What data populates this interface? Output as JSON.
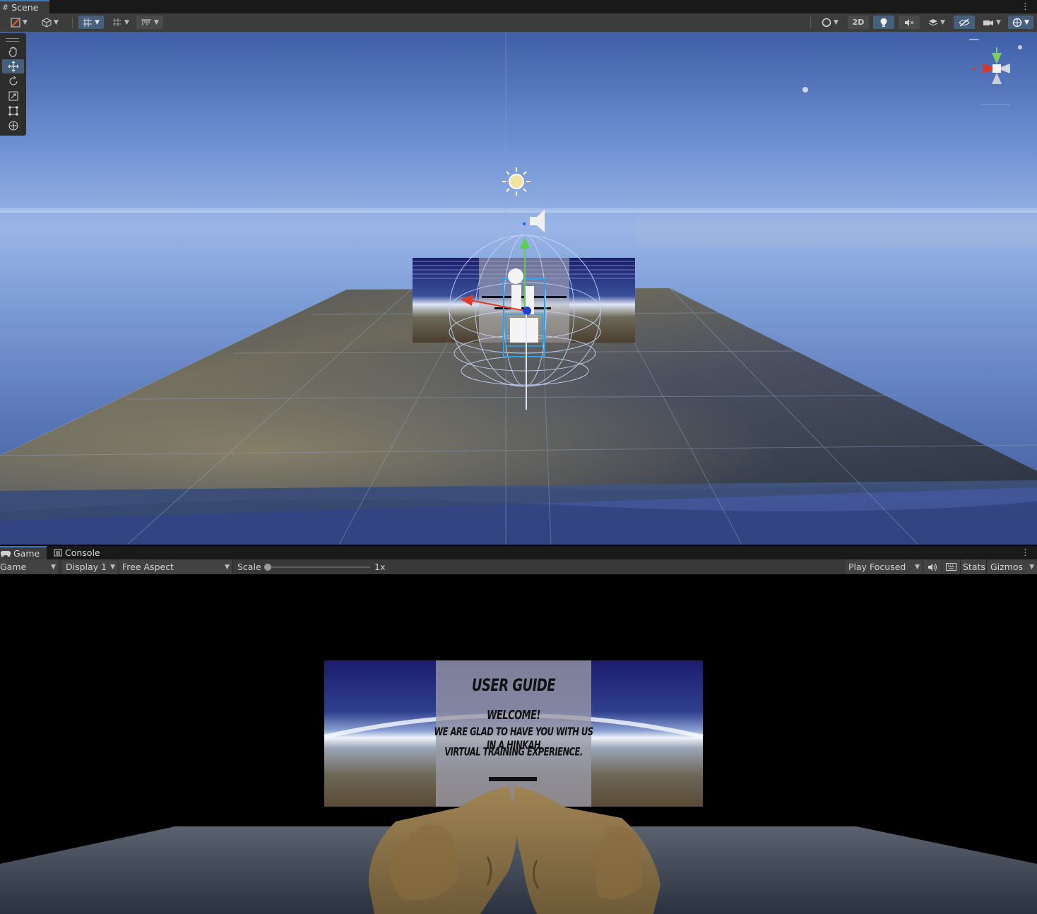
{
  "scene_tab": {
    "label": "Scene"
  },
  "scene_toolbar": {
    "view_2d_label": "2D"
  },
  "tools": [
    "hand-tool",
    "move-tool",
    "rotate-tool",
    "scale-tool",
    "rect-tool",
    "transform-tool"
  ],
  "bottom_tabs": [
    {
      "label": "Game",
      "icon": "gamepad-icon",
      "active": true
    },
    {
      "label": "Console",
      "icon": "console-icon",
      "active": false
    }
  ],
  "game_toolbar": {
    "view_select": "Game",
    "display_select": "Display 1",
    "aspect_select": "Free Aspect",
    "scale_label": "Scale",
    "scale_value_text": "1x",
    "scale_value": 1,
    "play_mode_select": "Play Focused",
    "stats_label": "Stats",
    "gizmos_label": "Gizmos"
  },
  "game_content": {
    "panel_title": "USER GUIDE",
    "panel_greeting": "WELCOME!",
    "panel_line_1": "WE ARE GLAD TO HAVE YOU WITH US IN A HINKAH",
    "panel_line_2": "VIRTUAL TRAINING EXPERIENCE."
  },
  "colors": {
    "accent": "#3a79bb",
    "tool_selected": "#46607c",
    "toolbar_bg": "#3c3c3c",
    "tab_bg": "#191919"
  }
}
